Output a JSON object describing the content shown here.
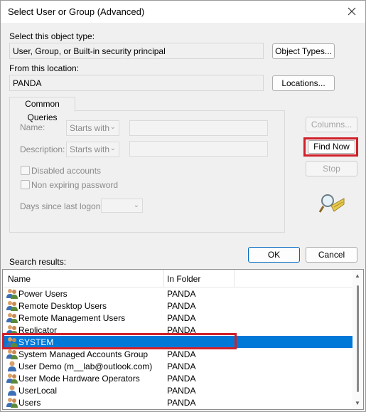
{
  "window": {
    "title": "Select User or Group (Advanced)"
  },
  "object_type": {
    "label": "Select this object type:",
    "value": "User, Group, or Built-in security principal",
    "button": "Object Types..."
  },
  "location": {
    "label": "From this location:",
    "value": "PANDA",
    "button": "Locations..."
  },
  "queries": {
    "tab": "Common Queries",
    "name_label": "Name:",
    "name_mode": "Starts with",
    "description_label": "Description:",
    "description_mode": "Starts with",
    "disabled_accounts": "Disabled accounts",
    "non_expiring": "Non expiring password",
    "days_label": "Days since last logon:"
  },
  "buttons": {
    "columns": "Columns...",
    "find_now": "Find Now",
    "stop": "Stop",
    "ok": "OK",
    "cancel": "Cancel"
  },
  "results": {
    "label": "Search results:",
    "columns": [
      "Name",
      "In Folder"
    ],
    "rows": [
      {
        "name": "Power Users",
        "folder": "PANDA",
        "icon": "group-icon"
      },
      {
        "name": "Remote Desktop Users",
        "folder": "PANDA",
        "icon": "group-icon"
      },
      {
        "name": "Remote Management Users",
        "folder": "PANDA",
        "icon": "group-icon"
      },
      {
        "name": "Replicator",
        "folder": "PANDA",
        "icon": "group-icon"
      },
      {
        "name": "SYSTEM",
        "folder": "",
        "icon": "group-icon",
        "selected": true
      },
      {
        "name": "System Managed Accounts Group",
        "folder": "PANDA",
        "icon": "group-icon"
      },
      {
        "name": "User Demo (m__lab@outlook.com)",
        "folder": "PANDA",
        "icon": "user-icon"
      },
      {
        "name": "User Mode Hardware Operators",
        "folder": "PANDA",
        "icon": "group-icon"
      },
      {
        "name": "UserLocal",
        "folder": "PANDA",
        "icon": "user-icon"
      },
      {
        "name": "Users",
        "folder": "PANDA",
        "icon": "group-icon"
      }
    ]
  },
  "colors": {
    "highlight": "#d0202a",
    "selection": "#0078d7"
  }
}
